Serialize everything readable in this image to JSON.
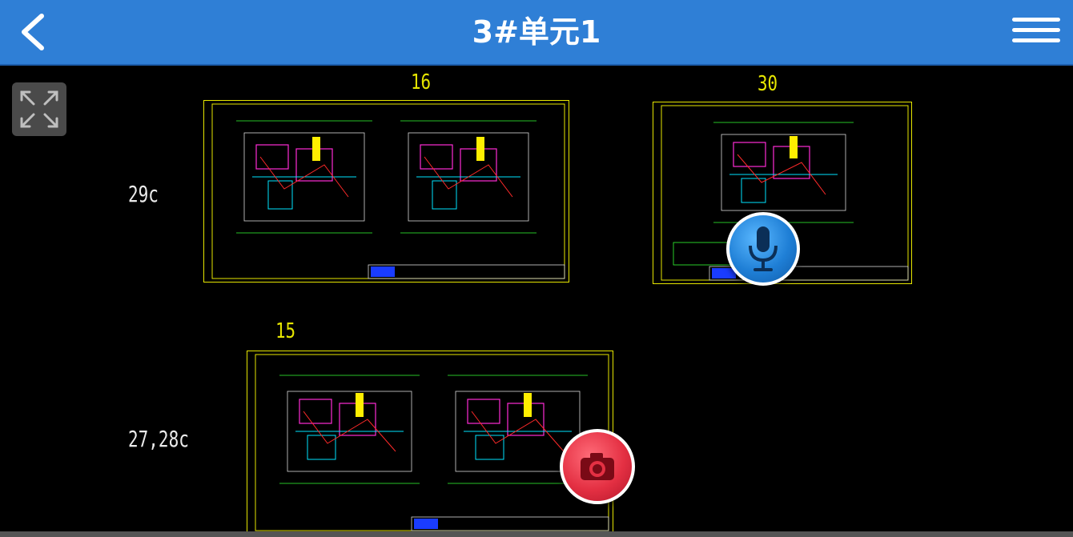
{
  "header": {
    "title": "3#单元1",
    "back_icon": "chevron-left-icon",
    "menu_icon": "hamburger-menu-icon"
  },
  "toolbar": {
    "expand_icon": "fullscreen-expand-icon"
  },
  "canvas": {
    "sheet_labels": {
      "sheet_16": "16",
      "sheet_30": "30",
      "sheet_15": "15"
    },
    "row_labels": {
      "row_1": "29c",
      "row_2": "27,28c"
    }
  },
  "actions": {
    "mic_icon": "microphone-icon",
    "camera_icon": "camera-icon"
  },
  "colors": {
    "header_bg": "#2f7fd6",
    "drawing_border": "#e6e600",
    "mic_button": "#1f7fd6",
    "camera_button": "#e43043"
  }
}
